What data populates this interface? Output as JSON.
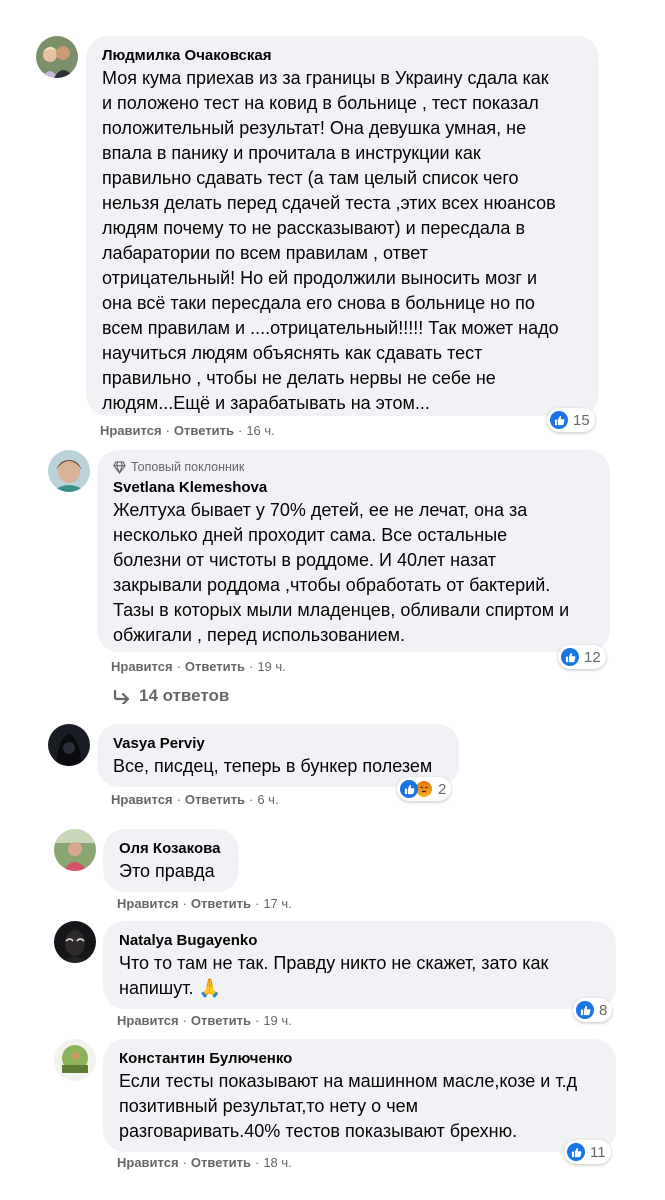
{
  "comments": [
    {
      "author": "Людмилка Очаковская",
      "text": "Моя кума приехав из за границы в Украину сдала как\nи положено тест на ковид в больнице , тест показал\nположительный результат! Она девушка умная, не\nвпала в панику и прочитала в инструкции как\nправильно сдавать тест (а там целый список чего\nнельзя делать перед сдачей теста ,этих всех нюансов\nлюдям почему то не рассказывают) и пересдала в\nлабаратории по всем правилам , ответ\nотрицательный! Но ей продолжили выносить мозг и\nона всё таки пересдала его снова в больнице но по\nвсем правилам и ....отрицательный!!!!! Так может надо\nнаучиться людям объяснять как сдавать тест\nправильно , чтобы не делать нервы не себе не\nлюдям...Ещё и зарабатывать на этом...",
      "like": "Нравится",
      "reply": "Ответить",
      "time": "16 ч.",
      "reactions": "15"
    },
    {
      "badge": "Топовый поклонник",
      "author": "Svetlana Klemeshova",
      "text": "Желтуха бывает у 70% детей, ее не лечат, она за\nнесколько дней проходит сама. Все остальные\nболезни от чистоты в роддоме. И 40лет назат\nзакрывали роддома ,чтобы обработать от бактерий.\nТазы в которых мыли младенцев, обливали спиртом и\nобжигали , перед использованием.",
      "like": "Нравится",
      "reply": "Ответить",
      "time": "19 ч.",
      "reactions": "12",
      "replies": "14 ответов"
    },
    {
      "author": "Vasya Perviy",
      "text": "Все, писдец, теперь в бункер полезем",
      "like": "Нравится",
      "reply": "Ответить",
      "time": "6 ч.",
      "reactions": "2"
    },
    {
      "author": "Оля Козакова",
      "text": "Это правда",
      "like": "Нравится",
      "reply": "Ответить",
      "time": "17 ч."
    },
    {
      "author": "Natalya Bugayenko",
      "text": "Что то там не так. Правду никто не скажет, зато как\nнапишут. 🙏",
      "like": "Нравится",
      "reply": "Ответить",
      "time": "19 ч.",
      "reactions": "8"
    },
    {
      "author": "Константин Булюченко",
      "text": "Если тесты показывают на машинном масле,козе и т.д\nпозитивный результат,то нету о чем\nразговаривать.40% тестов показывают брехню.",
      "like": "Нравится",
      "reply": "Ответить",
      "time": "18 ч.",
      "reactions": "11"
    }
  ],
  "colors": {
    "bubble": "#f0f2f5",
    "meta": "#65676b",
    "like_blue": "#1b74e4"
  }
}
